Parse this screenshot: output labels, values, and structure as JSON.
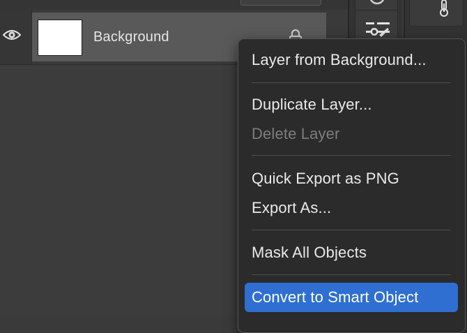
{
  "layers_panel": {
    "layer": {
      "name": "Background",
      "visible": true,
      "locked": true,
      "thumbnail_color": "#ffffff",
      "selected": true
    }
  },
  "context_menu": {
    "groups": [
      [
        {
          "label": "Layer from Background...",
          "enabled": true
        }
      ],
      [
        {
          "label": "Duplicate Layer...",
          "enabled": true
        },
        {
          "label": "Delete Layer",
          "enabled": false
        }
      ],
      [
        {
          "label": "Quick Export as PNG",
          "enabled": true
        },
        {
          "label": "Export As...",
          "enabled": true
        }
      ],
      [
        {
          "label": "Mask All Objects",
          "enabled": true
        }
      ],
      [
        {
          "label": "Convert to Smart Object",
          "enabled": true,
          "highlighted": true
        }
      ]
    ]
  },
  "icons": {
    "eye": "eye-icon",
    "lock": "lock-icon",
    "paint_adjust": "paint-adjustment-icon",
    "thermometer": "thermometer-icon",
    "half_circle": "half-circle-icon"
  },
  "colors": {
    "panel_bg": "#3c3c3c",
    "selected_row": "#595959",
    "menu_bg": "#2b2b2b",
    "menu_highlight": "#2f6fd1",
    "text": "#eaeaea",
    "text_disabled": "#7d7d7d"
  }
}
